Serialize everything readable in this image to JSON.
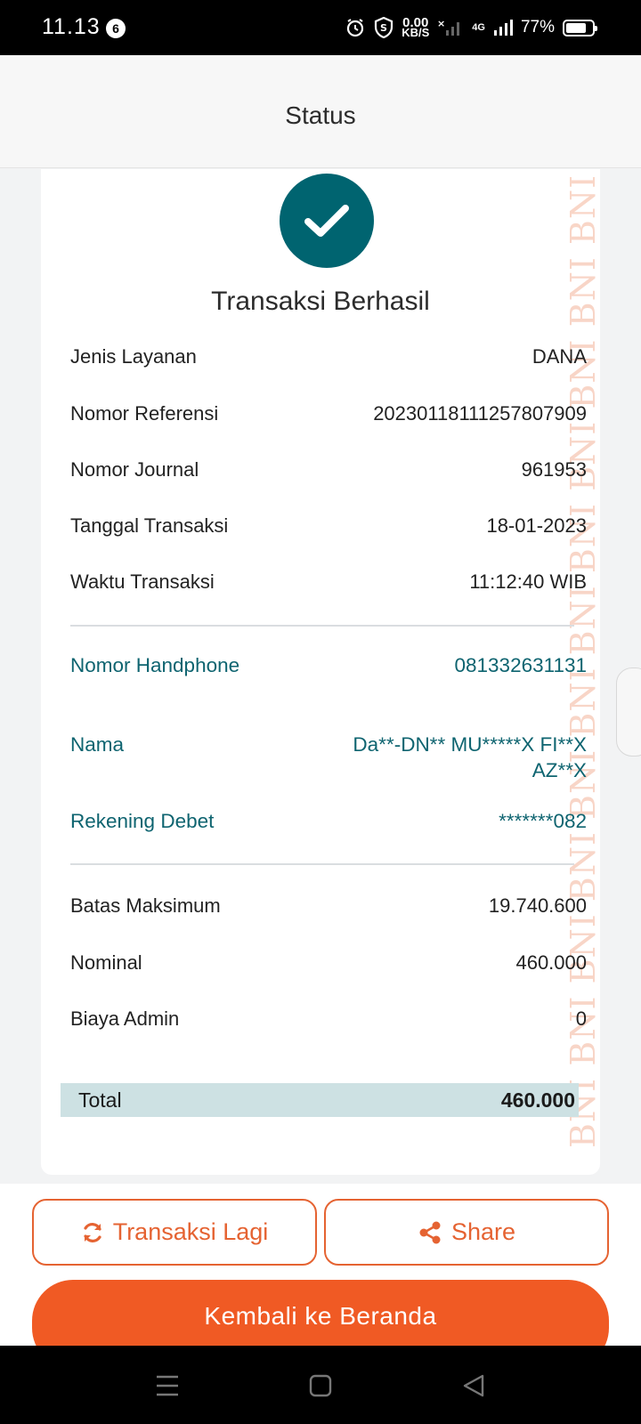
{
  "status_bar": {
    "time": "11.13",
    "notification_count": "6",
    "network_speed_value": "0.00",
    "network_speed_unit": "KB/S",
    "signal_label": "4G",
    "battery_percent": "77%",
    "battery_level": 0.77
  },
  "header": {
    "title": "Status"
  },
  "result": {
    "title": "Transaksi Berhasil",
    "icon": "checkmark-icon",
    "accent_color": "#006470"
  },
  "details": [
    {
      "label": "Jenis Layanan",
      "value": "DANA"
    },
    {
      "label": "Nomor Referensi",
      "value": "20230118111257807909"
    },
    {
      "label": "Nomor Journal",
      "value": "961953"
    },
    {
      "label": "Tanggal Transaksi",
      "value": "18-01-2023"
    },
    {
      "label": "Waktu Transaksi",
      "value": "11:12:40 WIB"
    }
  ],
  "customer": [
    {
      "label": "Nomor Handphone",
      "value": "081332631131"
    },
    {
      "label": "Nama",
      "value": "Da**-DN** MU*****X FI**X AZ**X"
    },
    {
      "label": "Rekening Debet",
      "value": "*******082"
    }
  ],
  "amounts": [
    {
      "label": "Batas Maksimum",
      "value": "19.740.600"
    },
    {
      "label": "Nominal",
      "value": "460.000"
    },
    {
      "label": "Biaya Admin",
      "value": "0"
    }
  ],
  "total": {
    "label": "Total",
    "value": "460.000"
  },
  "watermark": "BNI BNI BNI BNI BNI BNI BNI BNI BNI BNI BNI BNI BNI BNI BNI BNI BNI BNI BNI BNI BNI BNI BNI BNI BNI BNI BNI BNI",
  "actions": {
    "again_label": "Transaksi Lagi",
    "again_icon": "refresh-icon",
    "share_label": "Share",
    "share_icon": "share-icon",
    "home_label": "Kembali ke Beranda"
  },
  "colors": {
    "brand_orange": "#f05a24",
    "teal": "#0e6470",
    "total_bg": "#cde1e3"
  }
}
